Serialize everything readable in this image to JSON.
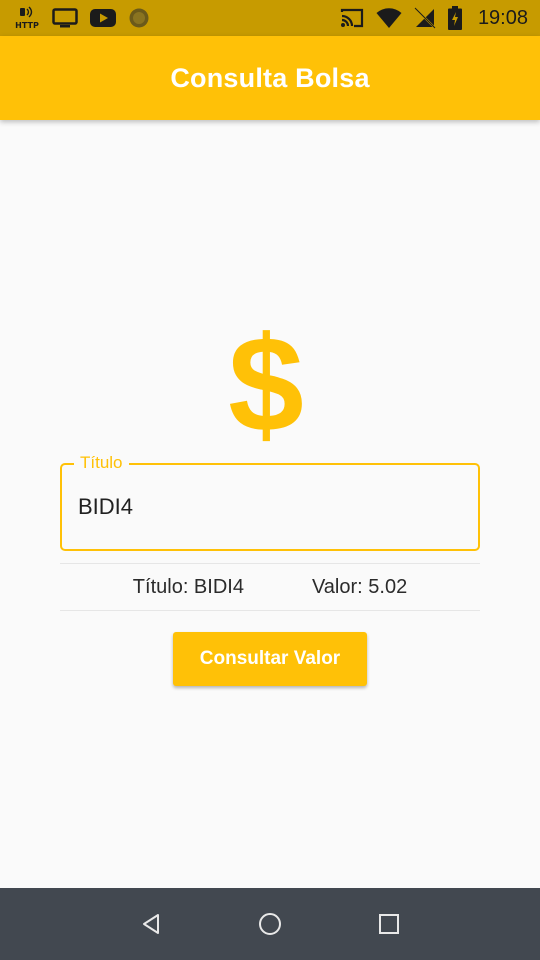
{
  "status_bar": {
    "time": "19:08",
    "icons": [
      "http-icon",
      "cast-screen-icon",
      "youtube-icon",
      "record-icon",
      "cast-icon",
      "wifi-icon",
      "no-sim-icon",
      "battery-charging-icon"
    ],
    "http_label": "HTTP"
  },
  "app_bar": {
    "title": "Consulta Bolsa"
  },
  "main": {
    "icon": "dollar-icon",
    "icon_glyph": "$",
    "field": {
      "label": "Título",
      "value": "BIDI4"
    },
    "result": {
      "titulo_text": "Título: BIDI4",
      "valor_text": "Valor: 5.02"
    },
    "button_label": "Consultar Valor"
  },
  "nav_bar": {
    "buttons": [
      "back-icon",
      "home-icon",
      "recents-icon"
    ]
  },
  "colors": {
    "primary": "#ffc107",
    "status_bar": "#c79b00",
    "nav_bar": "#424850",
    "background": "#fafafa"
  }
}
